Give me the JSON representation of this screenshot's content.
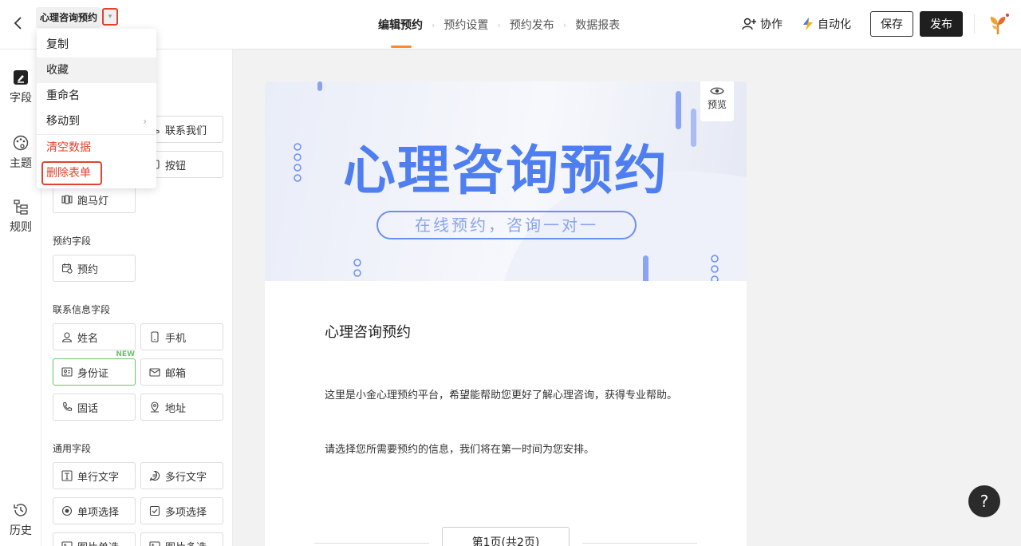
{
  "header": {
    "back_icon": "chevron-left-icon",
    "title": "心理咨询预约",
    "caret": "▾",
    "steps": [
      {
        "label": "编辑预约",
        "active": true
      },
      {
        "label": "预约设置",
        "active": false
      },
      {
        "label": "预约发布",
        "active": false
      },
      {
        "label": "数据报表",
        "active": false
      }
    ],
    "step_sep": "›",
    "collab_label": "协作",
    "automation_label": "自动化",
    "save_label": "保存",
    "publish_label": "发布"
  },
  "rail": {
    "items": [
      {
        "label": "字段",
        "icon": "edit-field-icon",
        "active": true
      },
      {
        "label": "主题",
        "icon": "palette-icon",
        "active": false
      },
      {
        "label": "规则",
        "icon": "rules-icon",
        "active": false
      },
      {
        "label": "历史",
        "icon": "history-icon",
        "active": false
      }
    ]
  },
  "menu": {
    "items": [
      {
        "label": "复制",
        "danger": false
      },
      {
        "label": "收藏",
        "danger": false,
        "hover": true
      },
      {
        "label": "重命名",
        "danger": false
      },
      {
        "label": "移动到",
        "danger": false,
        "submenu": true
      },
      {
        "label": "清空数据",
        "danger": true
      },
      {
        "label": "删除表单",
        "danger": true,
        "boxed": true
      }
    ],
    "submenu_arrow": "›"
  },
  "panel": {
    "partial_buttons": [
      {
        "label": "联系我们",
        "icon": "contact-icon"
      },
      {
        "label": "按钮",
        "icon": "button-icon"
      },
      {
        "label": "跑马灯",
        "icon": "marquee-icon"
      }
    ],
    "sections": [
      {
        "title": "预约字段",
        "fields": [
          {
            "label": "预约",
            "icon": "calendar-clock-icon"
          }
        ]
      },
      {
        "title": "联系信息字段",
        "fields": [
          {
            "label": "姓名",
            "icon": "person-icon"
          },
          {
            "label": "手机",
            "icon": "phone-icon"
          },
          {
            "label": "身份证",
            "icon": "id-card-icon",
            "tag": "NEW"
          },
          {
            "label": "邮箱",
            "icon": "mail-icon"
          },
          {
            "label": "固话",
            "icon": "telephone-icon"
          },
          {
            "label": "地址",
            "icon": "location-icon"
          }
        ]
      },
      {
        "title": "通用字段",
        "fields": [
          {
            "label": "单行文字",
            "icon": "single-line-icon"
          },
          {
            "label": "多行文字",
            "icon": "multi-line-icon"
          },
          {
            "label": "单项选择",
            "icon": "radio-icon"
          },
          {
            "label": "多项选择",
            "icon": "checkbox-icon"
          },
          {
            "label": "图片单选",
            "icon": "image-radio-icon"
          },
          {
            "label": "图片多选",
            "icon": "image-checkbox-icon"
          }
        ]
      }
    ]
  },
  "form": {
    "banner_title": "心理咨询预约",
    "banner_subtitle": "在线预约，咨询一对一",
    "preview_label": "预览",
    "heading": "心理咨询预约",
    "desc1": "这里是小金心理预约平台，希望能帮助您更好了解心理咨询，获得专业帮助。",
    "desc2": "请选择您所需要预约的信息，我们将在第一时间为您安排。",
    "pager": "第1页(共2页)"
  },
  "help_label": "?",
  "colors": {
    "accent": "#ff8a2a",
    "danger": "#e0432f",
    "brand_blue": "#4f7ef0",
    "new_green": "#6cc26c"
  }
}
